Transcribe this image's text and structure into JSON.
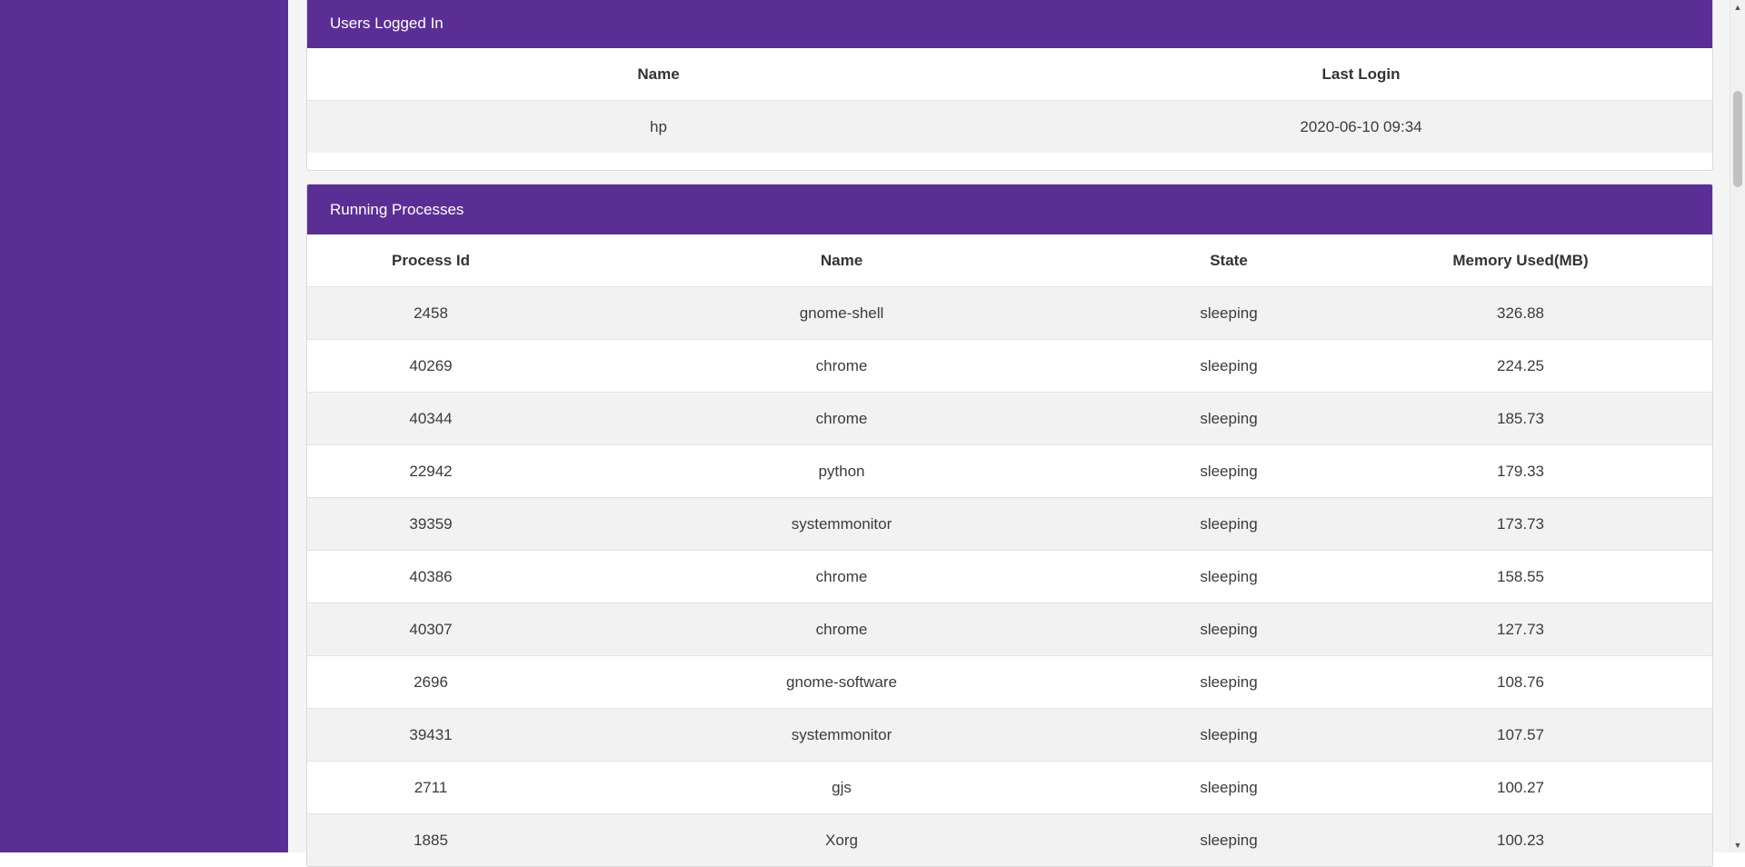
{
  "users_card": {
    "title": "Users Logged In",
    "columns": [
      "Name",
      "Last Login"
    ],
    "rows": [
      [
        "hp",
        "2020-06-10 09:34"
      ]
    ]
  },
  "processes_card": {
    "title": "Running Processes",
    "columns": [
      "Process Id",
      "Name",
      "State",
      "Memory Used(MB)"
    ],
    "rows": [
      [
        "2458",
        "gnome-shell",
        "sleeping",
        "326.88"
      ],
      [
        "40269",
        "chrome",
        "sleeping",
        "224.25"
      ],
      [
        "40344",
        "chrome",
        "sleeping",
        "185.73"
      ],
      [
        "22942",
        "python",
        "sleeping",
        "179.33"
      ],
      [
        "39359",
        "systemmonitor",
        "sleeping",
        "173.73"
      ],
      [
        "40386",
        "chrome",
        "sleeping",
        "158.55"
      ],
      [
        "40307",
        "chrome",
        "sleeping",
        "127.73"
      ],
      [
        "2696",
        "gnome-software",
        "sleeping",
        "108.76"
      ],
      [
        "39431",
        "systemmonitor",
        "sleeping",
        "107.57"
      ],
      [
        "2711",
        "gjs",
        "sleeping",
        "100.27"
      ],
      [
        "1885",
        "Xorg",
        "sleeping",
        "100.23"
      ]
    ]
  },
  "scrollbar": {
    "up_icon": "triangle-up-icon",
    "down_icon": "triangle-down-icon"
  },
  "colors": {
    "accent": "#5b2e96",
    "row_stripe": "#f2f2f2"
  }
}
